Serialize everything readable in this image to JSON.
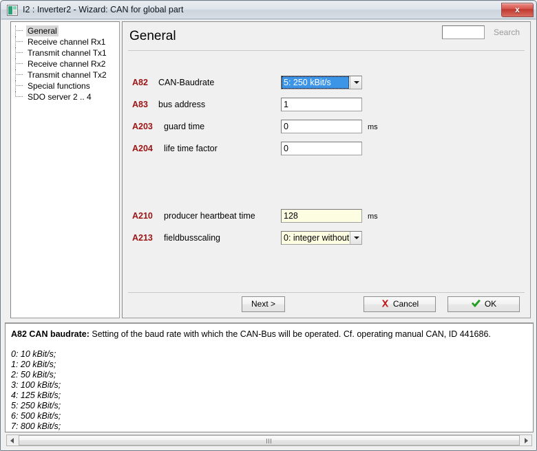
{
  "window": {
    "title": "I2 : Inverter2 - Wizard: CAN for global part",
    "app_icon": "window-icon",
    "close_label": "x"
  },
  "tree": {
    "items": [
      {
        "label": "General",
        "selected": true
      },
      {
        "label": "Receive channel Rx1",
        "selected": false
      },
      {
        "label": "Transmit channel Tx1",
        "selected": false
      },
      {
        "label": "Receive channel Rx2",
        "selected": false
      },
      {
        "label": "Transmit channel Tx2",
        "selected": false
      },
      {
        "label": "Special functions",
        "selected": false
      },
      {
        "label": "SDO server 2 .. 4",
        "selected": false
      }
    ]
  },
  "main": {
    "page_title": "General",
    "search": {
      "value": "",
      "placeholder": "",
      "button_label": "Search",
      "button_disabled": true
    },
    "fields": [
      {
        "code": "A82",
        "label": "CAN-Baudrate",
        "type": "combo",
        "value": "5: 250 kBit/s",
        "unit": "",
        "focused": true,
        "modified": false
      },
      {
        "code": "A83",
        "label": "bus address",
        "type": "text",
        "value": "1",
        "unit": "",
        "focused": false,
        "modified": false
      },
      {
        "code": "A203",
        "label": "guard time",
        "type": "text",
        "value": "0",
        "unit": "ms",
        "focused": false,
        "modified": false
      },
      {
        "code": "A204",
        "label": "life time factor",
        "type": "text",
        "value": "0",
        "unit": "",
        "focused": false,
        "modified": false
      },
      {
        "code": "A210",
        "label": "producer heartbeat time",
        "type": "text",
        "value": "128",
        "unit": "ms",
        "focused": false,
        "modified": true
      },
      {
        "code": "A213",
        "label": "fieldbusscaling",
        "type": "combo",
        "value": "0: integer without",
        "unit": "",
        "focused": false,
        "modified": true
      }
    ],
    "buttons": {
      "next": "Next >",
      "cancel": "Cancel",
      "ok": "OK"
    }
  },
  "help": {
    "lead_code": "A82  CAN baudrate:",
    "lead_text": " Setting of the baud rate with which the CAN-Bus will be operated. Cf. operating manual CAN, ID 441686.",
    "options": [
      "0: 10 kBit/s;",
      "1: 20 kBit/s;",
      "2: 50 kBit/s;",
      "3: 100 kBit/s;",
      "4: 125 kBit/s;",
      "5: 250 kBit/s;",
      "6: 500 kBit/s;",
      "7: 800 kBit/s;"
    ]
  },
  "colors": {
    "code_red": "#9b1414",
    "selection_blue": "#3d95e8",
    "modified_yellow": "#fdfde2",
    "cancel_red": "#c01c1c",
    "ok_green": "#1f9e1f"
  }
}
